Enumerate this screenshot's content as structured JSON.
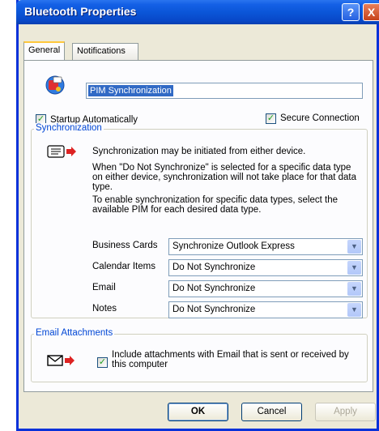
{
  "window": {
    "title": "Bluetooth Properties",
    "help_label": "?",
    "close_label": "X"
  },
  "tabs": [
    {
      "label": "General",
      "selected": true
    },
    {
      "label": "Notifications",
      "selected": false
    }
  ],
  "general": {
    "service_name": "PIM Synchronization",
    "startup_automatically": {
      "label": "Startup Automatically",
      "checked": true
    },
    "secure_connection": {
      "label": "Secure Connection",
      "checked": true
    }
  },
  "synchronization": {
    "group_title": "Synchronization",
    "para1": "Synchronization may be initiated from either device.",
    "para2": "When \"Do Not Synchronize\" is selected for a specific data type on either device, synchronization will not take place for that data type.",
    "para3": "To enable synchronization for specific data types, select the available PIM for each desired data type.",
    "rows": [
      {
        "label": "Business Cards",
        "value": "Synchronize Outlook Express"
      },
      {
        "label": "Calendar Items",
        "value": "Do Not Synchronize"
      },
      {
        "label": "Email",
        "value": "Do Not Synchronize"
      },
      {
        "label": "Notes",
        "value": "Do Not Synchronize"
      }
    ]
  },
  "email_attachments": {
    "group_title": "Email Attachments",
    "include_label": "Include attachments with Email that is sent or received by this computer",
    "checked": true
  },
  "buttons": {
    "ok": "OK",
    "cancel": "Cancel",
    "apply": "Apply"
  },
  "colors": {
    "titlebar": "#0b56d8",
    "group_title": "#0046d5",
    "selection": "#316ac5"
  },
  "icons": [
    "sync-icon",
    "pim-icon",
    "email-icon",
    "checkmark-icon",
    "dropdown-arrow-icon"
  ]
}
